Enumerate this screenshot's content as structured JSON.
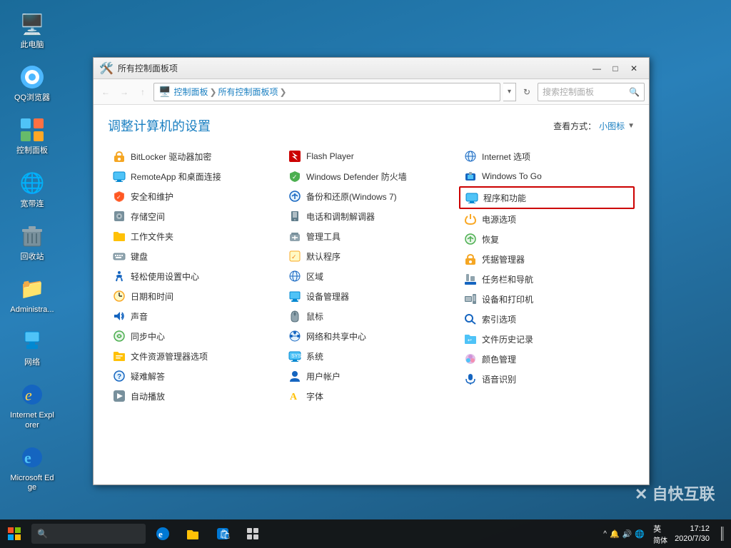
{
  "desktop": {
    "icons": [
      {
        "id": "this-pc",
        "label": "此电脑",
        "icon": "🖥️"
      },
      {
        "id": "qq-browser",
        "label": "QQ浏览器",
        "icon": "🌐"
      },
      {
        "id": "control-panel",
        "label": "控制面板",
        "icon": "🛠️"
      },
      {
        "id": "broadband",
        "label": "宽带连",
        "icon": "🔌"
      },
      {
        "id": "recycle-bin",
        "label": "回收站",
        "icon": "🗑️"
      },
      {
        "id": "administrator",
        "label": "Administra...",
        "icon": "📁"
      },
      {
        "id": "network",
        "label": "网络",
        "icon": "🌐"
      },
      {
        "id": "ie",
        "label": "Internet Explorer",
        "icon": "🌐"
      },
      {
        "id": "edge",
        "label": "Microsoft Edge",
        "icon": "🌐"
      }
    ]
  },
  "window": {
    "title": "所有控制面板项",
    "icon": "🛠️",
    "controls": {
      "minimize": "—",
      "maximize": "□",
      "close": "✕"
    },
    "address": {
      "back": "←",
      "forward": "→",
      "up": "↑",
      "path_parts": [
        "控制面板",
        "所有控制面板项"
      ],
      "refresh": "↻",
      "search_placeholder": "搜索控制面板"
    },
    "content_title": "调整计算机的设置",
    "view_label": "查看方式：",
    "view_current": "小图标",
    "view_arrow": "▼",
    "columns": [
      {
        "items": [
          {
            "id": "bitlocker",
            "icon": "🔒",
            "label": "BitLocker 驱动器加密"
          },
          {
            "id": "remoteapp",
            "icon": "🖥️",
            "label": "RemoteApp 和桌面连接"
          },
          {
            "id": "security",
            "icon": "🔰",
            "label": "安全和维护"
          },
          {
            "id": "storage",
            "icon": "💾",
            "label": "存储空间"
          },
          {
            "id": "workfolders",
            "icon": "📁",
            "label": "工作文件夹"
          },
          {
            "id": "keyboard",
            "icon": "⌨️",
            "label": "键盘"
          },
          {
            "id": "easyaccess",
            "icon": "♿",
            "label": "轻松使用设置中心"
          },
          {
            "id": "datetime",
            "icon": "🕐",
            "label": "日期和时间"
          },
          {
            "id": "sound",
            "icon": "🔊",
            "label": "声音"
          },
          {
            "id": "synccenter",
            "icon": "🔄",
            "label": "同步中心"
          },
          {
            "id": "fileexplorer",
            "icon": "📁",
            "label": "文件资源管理器选项"
          },
          {
            "id": "troubleshoot",
            "icon": "🔧",
            "label": "疑难解答"
          },
          {
            "id": "autoplay",
            "icon": "▶️",
            "label": "自动播放"
          }
        ]
      },
      {
        "items": [
          {
            "id": "flashplayer",
            "icon": "⚡",
            "label": "Flash Player"
          },
          {
            "id": "windefender",
            "icon": "🛡️",
            "label": "Windows Defender 防火墙"
          },
          {
            "id": "backup",
            "icon": "🔧",
            "label": "备份和还原(Windows 7)"
          },
          {
            "id": "phone",
            "icon": "📞",
            "label": "电话和调制解调器"
          },
          {
            "id": "admtools",
            "icon": "🔧",
            "label": "管理工具"
          },
          {
            "id": "default",
            "icon": "📋",
            "label": "默认程序"
          },
          {
            "id": "region",
            "icon": "🌍",
            "label": "区域"
          },
          {
            "id": "devmgr",
            "icon": "🖥️",
            "label": "设备管理器"
          },
          {
            "id": "mouse",
            "icon": "🖱️",
            "label": "鼠标"
          },
          {
            "id": "network",
            "icon": "🌐",
            "label": "网络和共享中心"
          },
          {
            "id": "system",
            "icon": "🖥️",
            "label": "系统"
          },
          {
            "id": "useraccount",
            "icon": "👤",
            "label": "用户帐户"
          },
          {
            "id": "fonts",
            "icon": "A",
            "label": "字体"
          }
        ]
      },
      {
        "items": [
          {
            "id": "internet",
            "icon": "🌐",
            "label": "Internet 选项"
          },
          {
            "id": "windowstogo",
            "icon": "🔧",
            "label": "Windows To Go"
          },
          {
            "id": "programs",
            "icon": "🖥️",
            "label": "程序和功能",
            "highlighted": true
          },
          {
            "id": "power",
            "icon": "⚡",
            "label": "电源选项"
          },
          {
            "id": "recovery",
            "icon": "🔄",
            "label": "恢复"
          },
          {
            "id": "credential",
            "icon": "🔑",
            "label": "凭据管理器"
          },
          {
            "id": "taskbar",
            "icon": "📋",
            "label": "任务栏和导航"
          },
          {
            "id": "devices",
            "icon": "🖨️",
            "label": "设备和打印机"
          },
          {
            "id": "indexing",
            "icon": "🔍",
            "label": "索引选项"
          },
          {
            "id": "filehistory",
            "icon": "📁",
            "label": "文件历史记录"
          },
          {
            "id": "colormgmt",
            "icon": "🎨",
            "label": "颜色管理"
          },
          {
            "id": "speech",
            "icon": "🎙️",
            "label": "语音识别"
          }
        ]
      }
    ]
  },
  "taskbar": {
    "start_icon": "⊞",
    "search_placeholder": "🔍",
    "apps": [
      {
        "id": "edge",
        "icon": "e",
        "color": "#0078d4"
      },
      {
        "id": "explorer",
        "icon": "📁",
        "color": "#ffc000"
      },
      {
        "id": "store",
        "icon": "🛍️",
        "color": "#0078d4"
      },
      {
        "id": "taskview",
        "icon": "⧉",
        "color": "white"
      }
    ],
    "tray": {
      "items": [
        "^",
        "🔔",
        "🔊",
        "🌐"
      ]
    },
    "lang": "英 简体",
    "time": "17:12",
    "date": "2020/7/30"
  },
  "watermark": "X 自快互联"
}
